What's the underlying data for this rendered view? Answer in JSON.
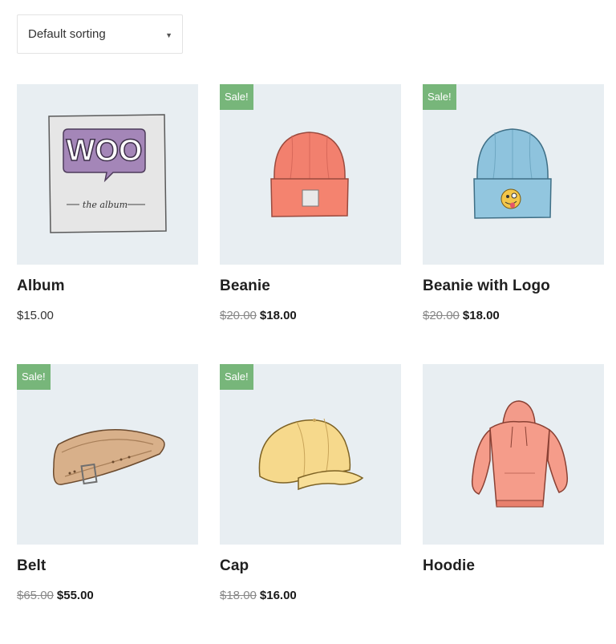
{
  "sorting": {
    "selected": "Default sorting"
  },
  "products": [
    {
      "name": "Album",
      "price": "$15.00",
      "on_sale": false
    },
    {
      "name": "Beanie",
      "old_price": "$20.00",
      "sale_price": "$18.00",
      "on_sale": true
    },
    {
      "name": "Beanie with Logo",
      "old_price": "$20.00",
      "sale_price": "$18.00",
      "on_sale": true
    },
    {
      "name": "Belt",
      "old_price": "$65.00",
      "sale_price": "$55.00",
      "on_sale": true
    },
    {
      "name": "Cap",
      "old_price": "$18.00",
      "sale_price": "$16.00",
      "on_sale": true
    },
    {
      "name": "Hoodie",
      "on_sale": false
    }
  ],
  "sale_label": "Sale!",
  "album_art": {
    "logo_text": "WOO",
    "caption": "the album"
  },
  "colors": {
    "sale_badge": "#77b67a",
    "image_bg": "#e8eef2"
  }
}
